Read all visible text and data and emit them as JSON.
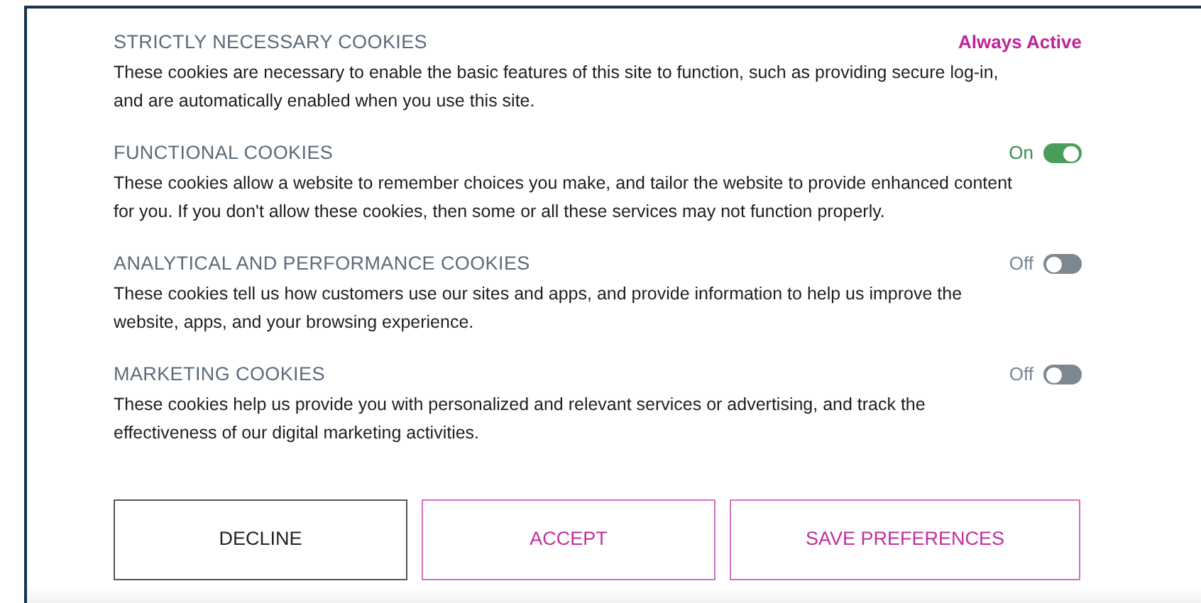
{
  "categories": [
    {
      "kind": "always",
      "title": "STRICTLY NECESSARY COOKIES",
      "status": "Always Active",
      "description": "These cookies are necessary to enable the basic features of this site to function, such as providing secure log-in, and are automatically enabled when you use this site."
    },
    {
      "kind": "toggle",
      "title": "FUNCTIONAL COOKIES",
      "status": "On",
      "on": true,
      "description": "These cookies allow a website to remember choices you make, and tailor the website to provide enhanced content for you. If you don't allow these cookies, then some or all these services may not function properly."
    },
    {
      "kind": "toggle",
      "title": "ANALYTICAL AND PERFORMANCE COOKIES",
      "status": "Off",
      "on": false,
      "description": "These cookies tell us how customers use our sites and apps, and provide information to help us improve the website, apps, and your browsing experience."
    },
    {
      "kind": "toggle",
      "title": "MARKETING COOKIES",
      "status": "Off",
      "on": false,
      "description": "These cookies help us provide you with personalized and relevant services or advertising, and track the effectiveness of our digital marketing activities."
    }
  ],
  "buttons": [
    {
      "label": "DECLINE",
      "kind": "neutral"
    },
    {
      "label": "ACCEPT",
      "kind": "accent"
    },
    {
      "label": "SAVE PREFERENCES",
      "kind": "accent"
    }
  ]
}
